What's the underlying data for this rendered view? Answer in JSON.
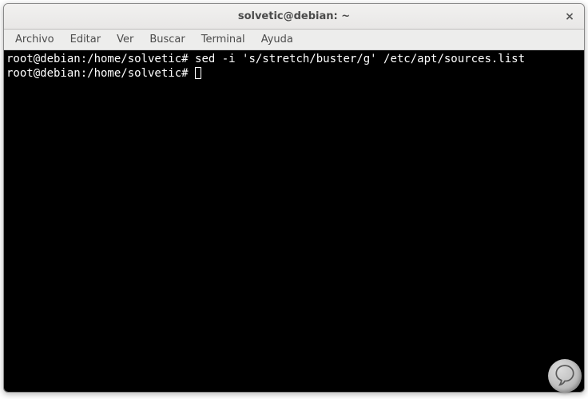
{
  "window": {
    "title": "solvetic@debian: ~"
  },
  "menubar": {
    "items": [
      {
        "label": "Archivo"
      },
      {
        "label": "Editar"
      },
      {
        "label": "Ver"
      },
      {
        "label": "Buscar"
      },
      {
        "label": "Terminal"
      },
      {
        "label": "Ayuda"
      }
    ]
  },
  "terminal": {
    "lines": [
      {
        "prompt": "root@debian:/home/solvetic#",
        "command": "sed -i 's/stretch/buster/g' /etc/apt/sources.list"
      },
      {
        "prompt": "root@debian:/home/solvetic#",
        "command": ""
      }
    ]
  },
  "icons": {
    "close": "×"
  }
}
